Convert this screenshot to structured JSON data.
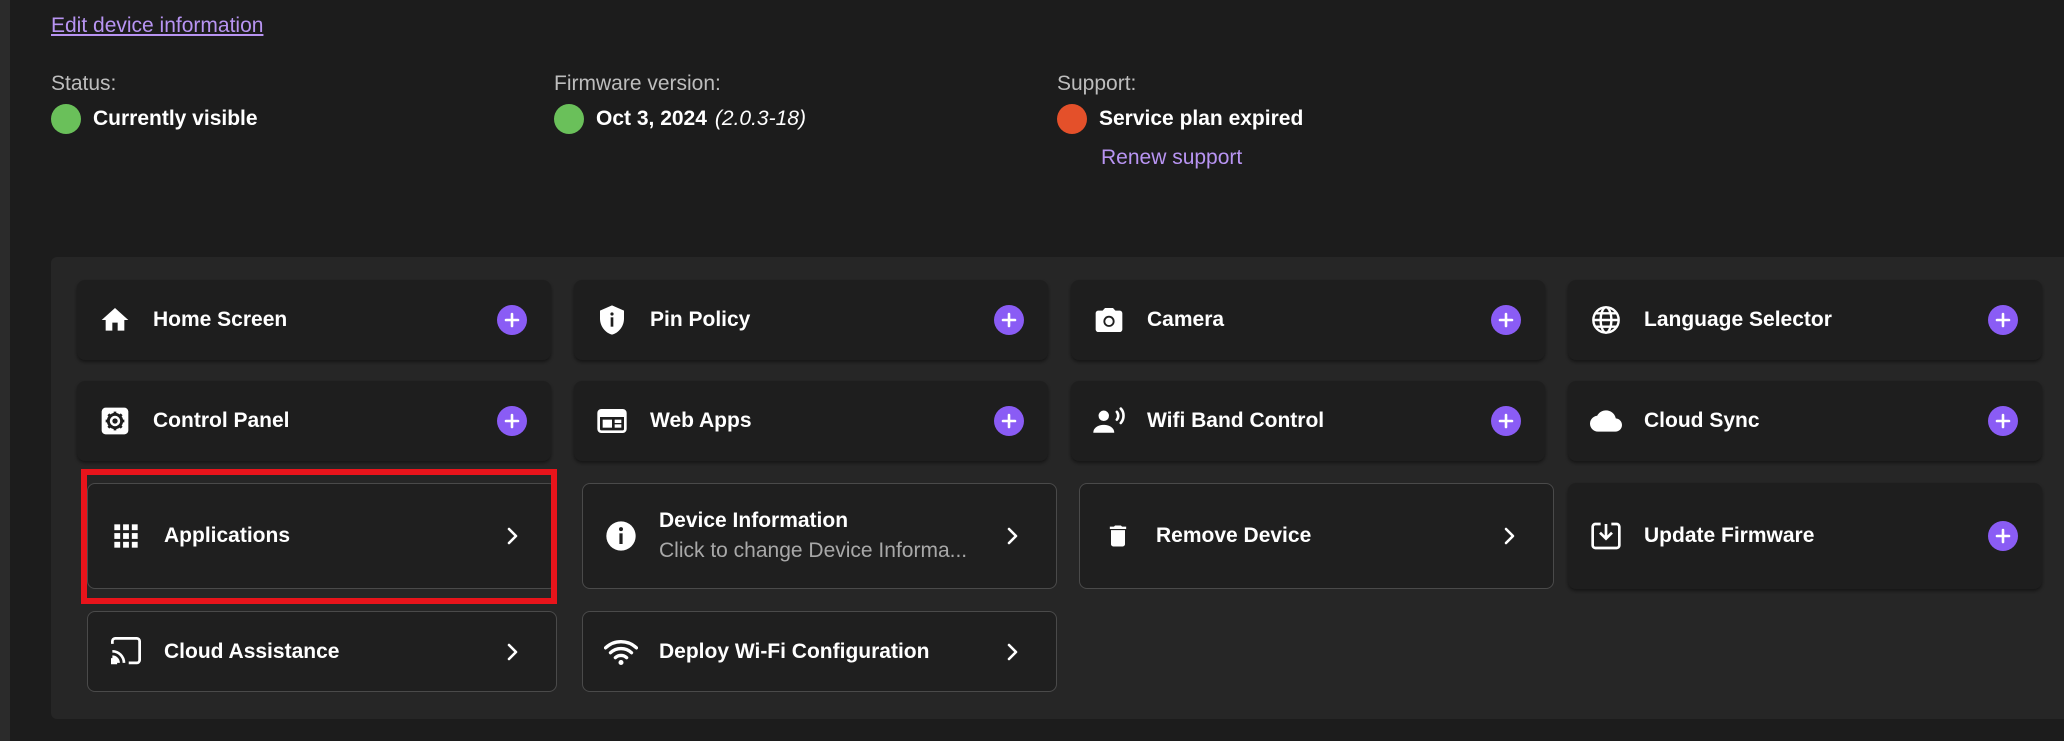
{
  "header": {
    "edit_link": "Edit device information"
  },
  "status": {
    "label": "Status:",
    "value": "Currently visible",
    "color": "#6ac05a"
  },
  "firmware": {
    "label": "Firmware version:",
    "date": "Oct 3, 2024",
    "version": "(2.0.3-18)",
    "color": "#6ac05a"
  },
  "support": {
    "label": "Support:",
    "value": "Service plan expired",
    "color": "#e4502a",
    "renew_link": "Renew support"
  },
  "tiles": [
    {
      "label": "Home Screen",
      "icon": "home-icon",
      "action": "add"
    },
    {
      "label": "Pin Policy",
      "icon": "shield-info-icon",
      "action": "add"
    },
    {
      "label": "Camera",
      "icon": "camera-icon",
      "action": "add"
    },
    {
      "label": "Language Selector",
      "icon": "globe-icon",
      "action": "add"
    },
    {
      "label": "Control Panel",
      "icon": "settings-box-icon",
      "action": "add"
    },
    {
      "label": "Web Apps",
      "icon": "web-window-icon",
      "action": "add"
    },
    {
      "label": "Wifi Band Control",
      "icon": "person-voice-icon",
      "action": "add"
    },
    {
      "label": "Cloud Sync",
      "icon": "cloud-icon",
      "action": "add"
    },
    {
      "label": "Applications",
      "icon": "apps-grid-icon",
      "action": "open"
    },
    {
      "label": "Device Information",
      "sublabel": "Click to change Device Informa...",
      "icon": "info-circle-icon",
      "action": "open"
    },
    {
      "label": "Remove Device",
      "icon": "trash-icon",
      "action": "open"
    },
    {
      "label": "Update Firmware",
      "icon": "download-box-icon",
      "action": "add"
    },
    {
      "label": "Cloud Assistance",
      "icon": "cast-icon",
      "action": "open"
    },
    {
      "label": "Deploy Wi-Fi Configuration",
      "icon": "wifi-icon",
      "action": "open"
    }
  ],
  "colors": {
    "accent": "#8a5cf5",
    "link": "#b894f2",
    "highlight": "#e8141b"
  }
}
